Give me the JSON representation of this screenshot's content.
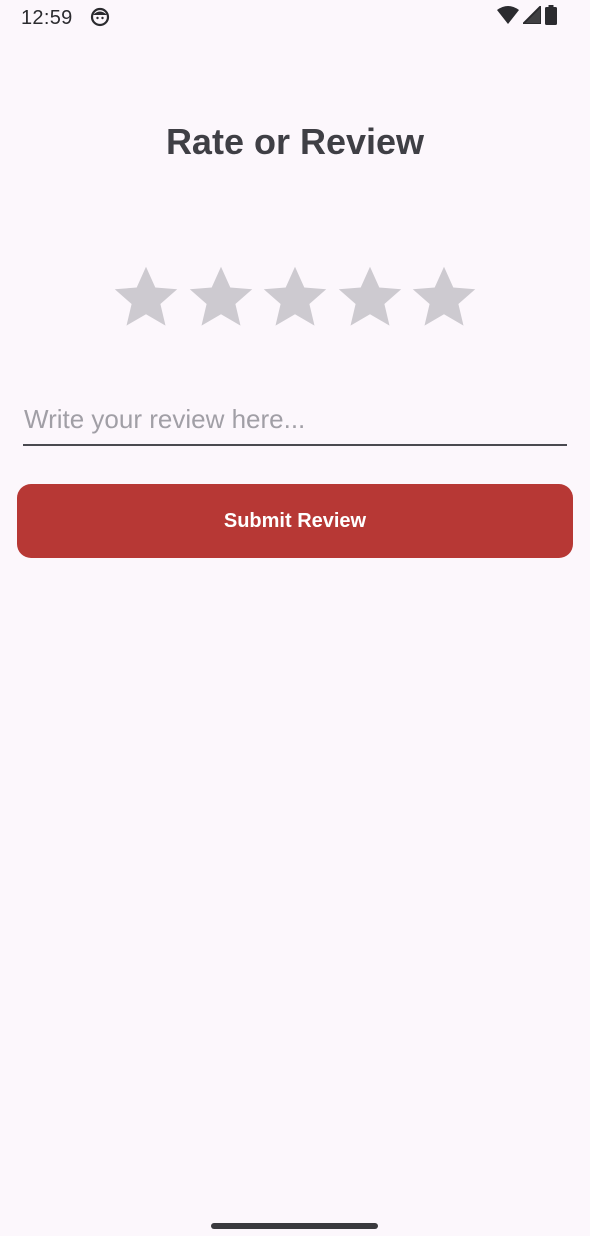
{
  "status_bar": {
    "time": "12:59",
    "app_icon": "face-icon",
    "icons": [
      "wifi-icon",
      "cell-signal-icon",
      "battery-icon"
    ]
  },
  "page": {
    "title": "Rate or Review"
  },
  "rating": {
    "max": 5,
    "value": 0,
    "star_color": "#CDCAD0",
    "star_icon": "star-icon"
  },
  "review": {
    "placeholder": "Write your review here...",
    "value": ""
  },
  "submit": {
    "label": "Submit Review",
    "color": "#B73835"
  },
  "theme": {
    "background": "#FCF7FC",
    "text": "#3F3F45"
  }
}
